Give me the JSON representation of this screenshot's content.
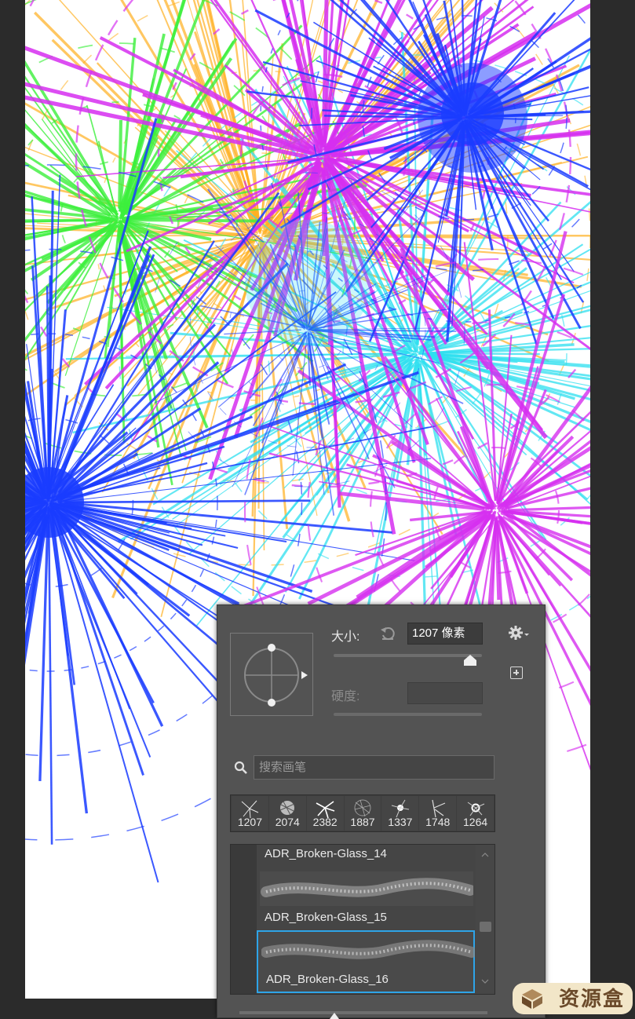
{
  "brush_panel": {
    "size_label": "大小:",
    "size_value": "1207 像素",
    "size_level_fraction": 0.92,
    "hardness_label": "硬度:",
    "search_placeholder": "搜索画笔",
    "recent_brushes": [
      "1207",
      "2074",
      "2382",
      "1887",
      "1337",
      "1748",
      "1264"
    ],
    "presets": [
      {
        "name": "ADR_Broken-Glass_14",
        "selected": false
      },
      {
        "name": "ADR_Broken-Glass_15",
        "selected": false
      },
      {
        "name": "ADR_Broken-Glass_16",
        "selected": true
      }
    ]
  },
  "watermark": {
    "text": "资源盒"
  },
  "colors": {
    "panel_bg": "#535353",
    "selection_accent": "#2ea4e8",
    "paint_blue": "#1a3cff",
    "paint_magenta": "#d62ff0",
    "paint_cyan": "#2ee0f0",
    "paint_green": "#3cf03c",
    "paint_orange": "#ffb020"
  }
}
